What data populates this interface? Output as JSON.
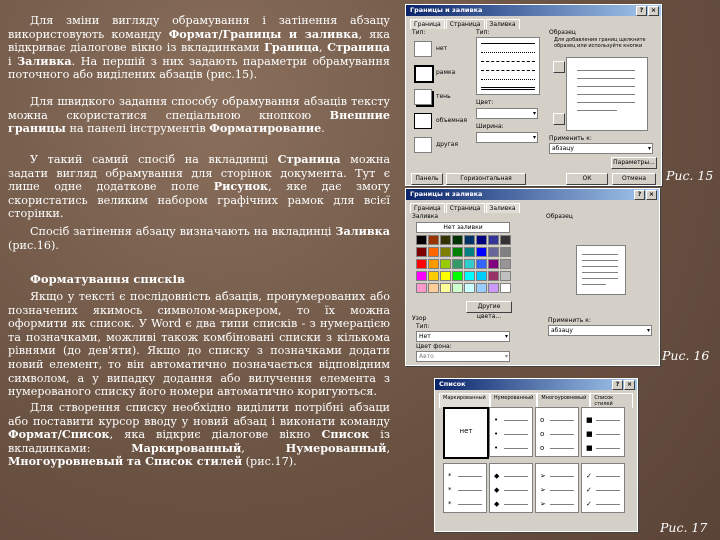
{
  "text": {
    "p1_lines": [
      "Для зміни вигляду обрамування і затінення абзацу використовують команду",
      "Формат/Границы и заливка",
      ", яка відкриває діалогове вікно із вкладинками ",
      "Граница",
      ", ",
      "Страница",
      " і ",
      "Заливка",
      ". На першій з них задають параметри обрамування поточного або виділених абзаців (рис.15)."
    ],
    "p2_a": "Для швидкого задання способу обрамування абзаців тексту можна скористатися спеціальною кнопкою ",
    "p2_b": "Внешние границы",
    "p2_c": " на панелі інструментів ",
    "p2_d": "Форматирование",
    "p2_e": ".",
    "p3_a": "У такий самий спосіб на вкладинці ",
    "p3_b": "Страница",
    "p3_c": " можна задати вигляд обрамування для сторінок документа. Тут є лише одне додаткове поле ",
    "p3_d": "Рисунок",
    "p3_e": ", яке дає змогу скористатись великим набором графічних рамок для всієї сторінки.",
    "p4_a": "Спосіб затінення абзацу визначають на вкладинці ",
    "p4_b": "Заливка",
    "p4_c": " (рис.16).",
    "heading": "Форматування списків",
    "p5": "Якщо у тексті є послідовність абзаців, пронумерованих або позначених якимось символом-маркером, то їх можна оформити як список. У Word є два типи списків - з нумерацією та позначками, можливі також комбіновані списки з кількома рівнями (до дев'яти). Якщо до списку з позначками додати новий елемент, то він автоматично позначається відповідним символом, а у випадку додання або вилучення елемента з нумерованого списку його номери автоматично коригуються.",
    "p6_a": "Для створення списку необхідно виділити потрібні абзаци або поставити курсор вводу у новий абзац і виконати команду ",
    "p6_b": "Формат/Список",
    "p6_c": ", яка відкриє діалогове вікно ",
    "p6_d": "Список",
    "p6_e": " із вкладинками: ",
    "p6_f": "Маркированный",
    "p6_g": ", ",
    "p6_h": "Нумерованный",
    "p6_i": ", ",
    "p6_j": "Многоуровневый та Список стилей",
    "p6_k": " (рис.17)."
  },
  "captions": {
    "fig15": "Рис. 15",
    "fig16": "Рис. 16",
    "fig17": "Рис. 17"
  },
  "dialog15": {
    "title": "Границы и заливка",
    "tabs": [
      "Граница",
      "Страница",
      "Заливка"
    ],
    "type_label": "Тип:",
    "type_items": [
      "нет",
      "рамка",
      "тень",
      "объемная",
      "другая"
    ],
    "style_label": "Тип:",
    "sample_label": "Образец",
    "sample_hint": "Для добавления границ щелкните образец или используйте кнопки",
    "color_label": "Цвет:",
    "width_label": "Ширина:",
    "apply_label": "Применить к:",
    "apply_value": "абзацу",
    "params_button": "Параметры...",
    "bottom_buttons": [
      "Панель",
      "Горизонтальная линия...",
      "ОК",
      "Отмена"
    ]
  },
  "dialog16": {
    "title": "Границы и заливка",
    "tabs": [
      "Граница",
      "Страница",
      "Заливка"
    ],
    "fill_label": "Заливка",
    "no_fill": "Нет заливки",
    "other_colors": "Другие цвета...",
    "pattern_label": "Узор",
    "type_label": "Тип:",
    "type_value": "Нет",
    "color_label": "Цвет фона:",
    "color_value": "Авто",
    "sample_label": "Образец",
    "apply_label": "Применить к:",
    "apply_value": "абзацу",
    "colors": [
      "#000000",
      "#993300",
      "#333300",
      "#003300",
      "#003366",
      "#000080",
      "#333399",
      "#333333",
      "#800000",
      "#ff6600",
      "#808000",
      "#008000",
      "#008080",
      "#0000ff",
      "#666699",
      "#808080",
      "#ff0000",
      "#ff9900",
      "#99cc00",
      "#339966",
      "#33cccc",
      "#3366ff",
      "#800080",
      "#969696",
      "#ff00ff",
      "#ffcc00",
      "#ffff00",
      "#00ff00",
      "#00ffff",
      "#00ccff",
      "#993366",
      "#c0c0c0",
      "#ff99cc",
      "#ffcc99",
      "#ffff99",
      "#ccffcc",
      "#ccffff",
      "#99ccff",
      "#cc99ff",
      "#ffffff"
    ]
  },
  "dialog17": {
    "title": "Список",
    "tabs": [
      "Маркированный",
      "Нумерованный",
      "Многоуровневый",
      "Список стилей"
    ],
    "none_label": "нет",
    "bullets_row1": [
      "•",
      "o",
      "■"
    ],
    "bullets_row2": [
      "◆",
      "➢",
      "✓"
    ]
  }
}
